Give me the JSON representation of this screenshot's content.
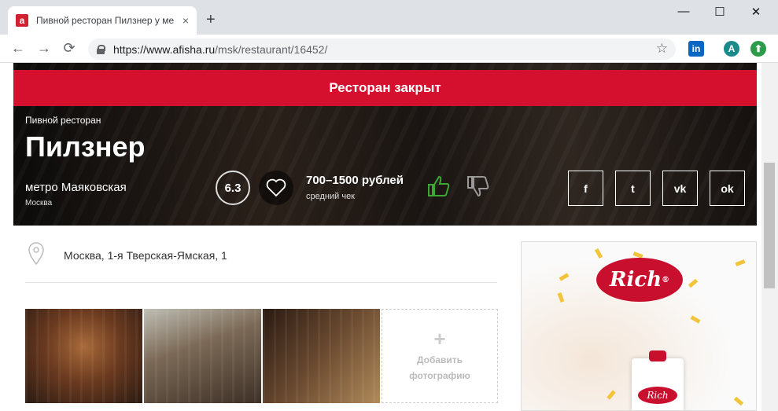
{
  "browser": {
    "tab_title": "Пивной ресторан Пилзнер у ме",
    "favicon": "a",
    "tab_close": "×",
    "new_tab": "+",
    "url_host": "https://www.afisha.ru",
    "url_path": "/msk/restaurant/16452/",
    "window_minimize": "—",
    "window_maximize": "☐",
    "window_close": "✕",
    "back": "←",
    "forward": "→",
    "reload": "⟳",
    "star": "☆",
    "ext_linkedin": "in",
    "ext_profile": "A",
    "ext_green": "⬆",
    "colors": {
      "linkedin": "#0a66c2",
      "profile": "#1a8a8a",
      "green": "#2c9c4a"
    }
  },
  "hero": {
    "closed_banner": "Ресторан закрыт",
    "category": "Пивной ресторан",
    "name": "Пилзнер",
    "metro": "метро Маяковская",
    "city": "Москва",
    "rating": "6.3",
    "price": "700–1500 рублей",
    "price_label": "средний чек",
    "social": [
      "f",
      "t",
      "vk",
      "ok"
    ],
    "colors": {
      "banner": "#d5102f",
      "like": "#3aa832",
      "dislike": "#999999"
    }
  },
  "content": {
    "address": "Москва, 1-я Тверская-Ямская, 1",
    "add_photo_label": "Добавить фотографию",
    "add_photo_plus": "+"
  },
  "ad": {
    "brand": "Rich",
    "brand_mark": "®"
  }
}
